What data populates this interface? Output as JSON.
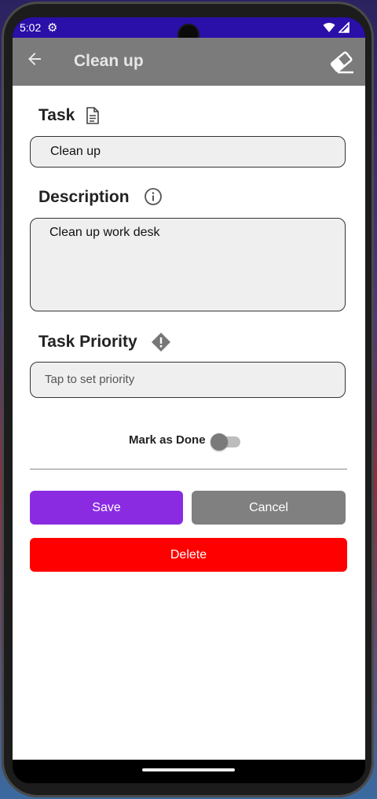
{
  "status": {
    "time": "5:02"
  },
  "appbar": {
    "title": "Clean up"
  },
  "task": {
    "label": "Task",
    "value": "Clean up"
  },
  "description": {
    "label": "Description",
    "value": "Clean up work desk"
  },
  "priority": {
    "label": "Task Priority",
    "placeholder": "Tap to set priority"
  },
  "mark_done": {
    "label": "Mark as Done",
    "checked": false
  },
  "buttons": {
    "save": "Save",
    "cancel": "Cancel",
    "delete": "Delete"
  },
  "colors": {
    "status_bar": "#2a0fa8",
    "app_bar": "#7b7b7b",
    "save": "#8a2be2",
    "cancel": "#808080",
    "delete": "#ff0000"
  },
  "icons": [
    "back-arrow-icon",
    "eraser-icon",
    "document-icon",
    "info-icon",
    "priority-icon",
    "gear-icon",
    "wifi-icon",
    "signal-icon"
  ]
}
